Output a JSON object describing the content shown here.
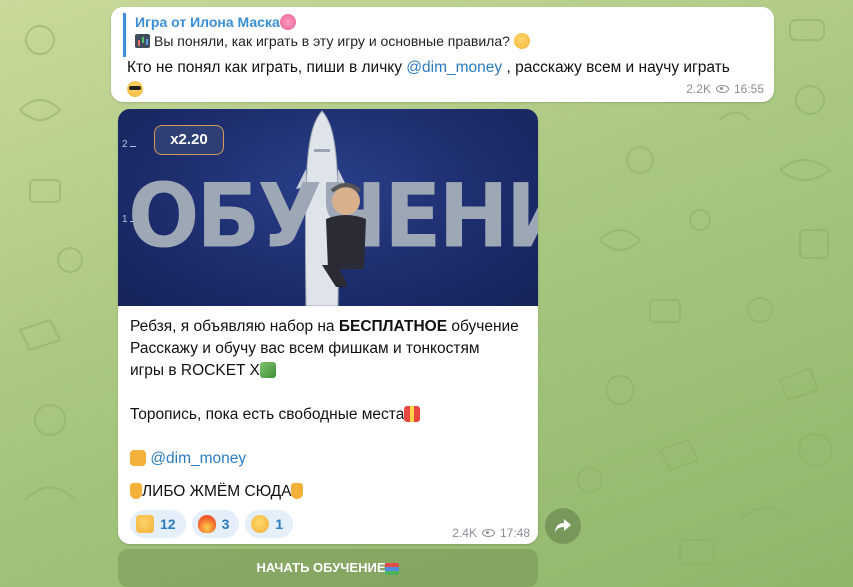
{
  "message1": {
    "reply_title": "Игра от Илона Маска",
    "reply_title_emoji": "brain",
    "reply_text": "Вы поняли, как играть в эту игру и основные правила?",
    "reply_icon": "bar-chart-icon",
    "text_part1": "Кто не понял как играть, пиши в личку ",
    "link": "@dim_money",
    "text_part2": " , расскажу всем и научу играть",
    "views": "2.2K",
    "time": "16:55"
  },
  "banner": {
    "multiplier": "x2.20",
    "axis_top": "2",
    "axis_bottom": "1",
    "big_word": "ОБУЧЕНИЕ",
    "rocket_label": "ROCKET"
  },
  "post": {
    "line1_pre": "Ребзя, я объявляю набор на ",
    "line1_bold": "БЕСПЛАТНОЕ",
    "line1_post": " обучение",
    "line2": "Расскажу и обучу вас всем фишкам и тонкостям",
    "line3": "игры в ROCKET X",
    "line4": "Торопись, пока есть свободные места",
    "link": "@dim_money",
    "cta": "ЛИБО ЖМЁМ СЮДА",
    "views": "2.4K",
    "time": "17:48"
  },
  "reactions": [
    {
      "emoji": "thumbs-up",
      "count": "12"
    },
    {
      "emoji": "fire",
      "count": "3"
    },
    {
      "emoji": "thinking-face",
      "count": "1"
    }
  ],
  "button": {
    "label": "НАЧАТЬ ОБУЧЕНИЕ"
  },
  "colors": {
    "accent": "#3a8fd6",
    "link": "#2b7bc0",
    "banner_bg": "#1c2c6b"
  }
}
